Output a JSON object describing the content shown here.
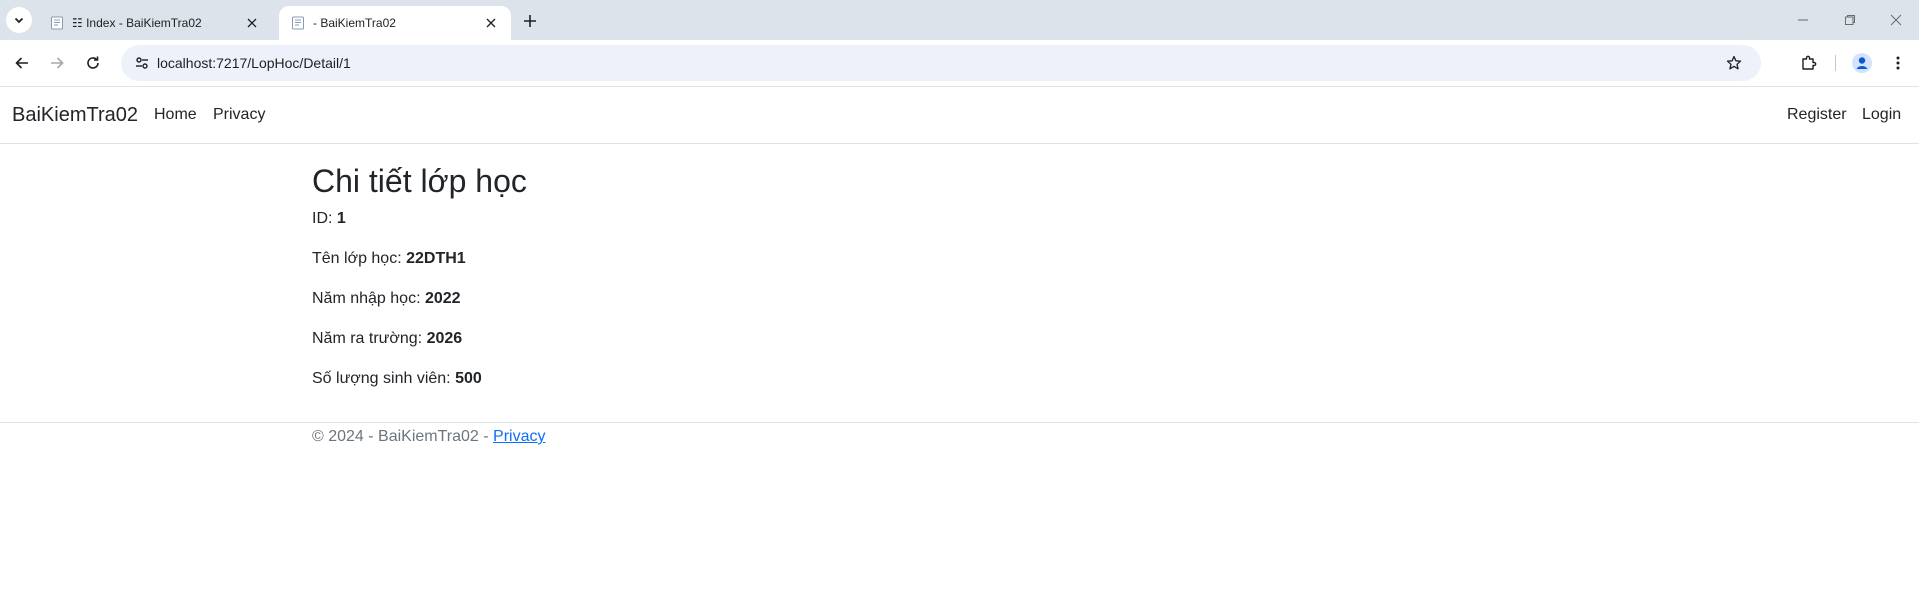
{
  "browser": {
    "tabs": [
      {
        "title": "☷ Index - BaiKiemTra02",
        "active": false
      },
      {
        "title": "- BaiKiemTra02",
        "active": true
      }
    ],
    "url": "localhost:7217/LopHoc/Detail/1"
  },
  "navbar": {
    "brand": "BaiKiemTra02",
    "links": [
      "Home",
      "Privacy"
    ],
    "right_links": [
      "Register",
      "Login"
    ]
  },
  "page": {
    "title": "Chi tiết lớp học",
    "fields": [
      {
        "label": "ID: ",
        "value": "1"
      },
      {
        "label": "Tên lớp học: ",
        "value": "22DTH1"
      },
      {
        "label": "Năm nhập học: ",
        "value": "2022"
      },
      {
        "label": "Năm ra trường: ",
        "value": "2026"
      },
      {
        "label": "Số lượng sinh viên: ",
        "value": "500"
      }
    ]
  },
  "footer": {
    "text": "© 2024 - BaiKiemTra02 - ",
    "link": "Privacy"
  },
  "colors": {
    "tabbar_bg": "#dde3ea",
    "omnibox_bg": "#edf2fa",
    "link": "#0d6efd",
    "muted_text": "#6c757d"
  }
}
